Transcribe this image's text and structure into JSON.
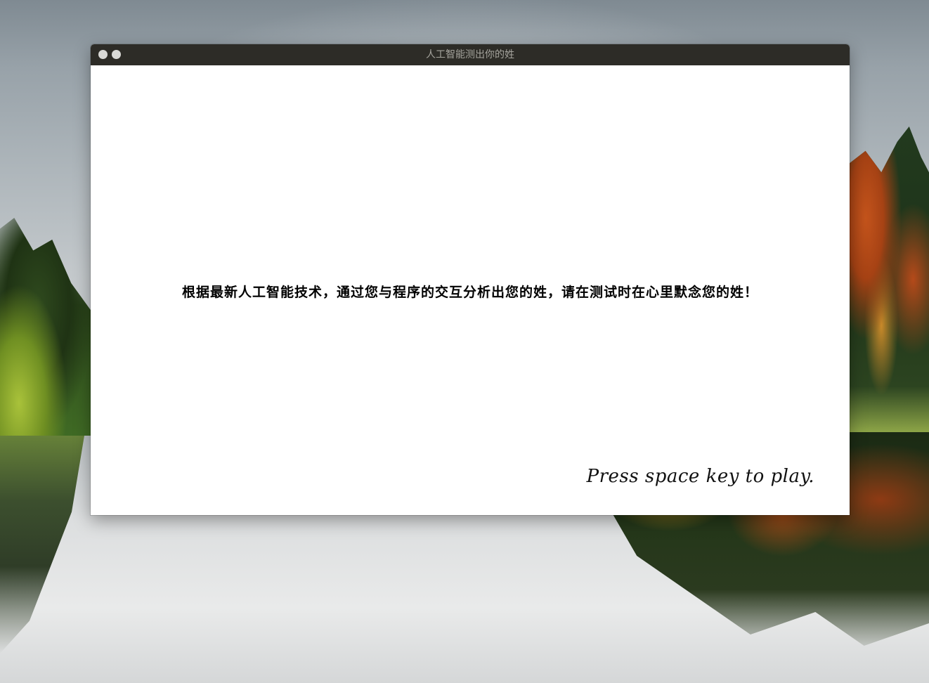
{
  "window": {
    "title": "人工智能测出你的姓",
    "controls": [
      "close-icon",
      "minimize-icon"
    ]
  },
  "content": {
    "intro_text": "根据最新人工智能技术，通过您与程序的交互分析出您的姓，请在测试时在心里默念您的姓！",
    "play_hint": "Press space key to play."
  },
  "colors": {
    "titlebar_bg": "#2d2c27",
    "title_text": "#a5a49d",
    "control_dot": "#d9d9d6",
    "content_bg": "#ffffff",
    "text": "#000000"
  }
}
